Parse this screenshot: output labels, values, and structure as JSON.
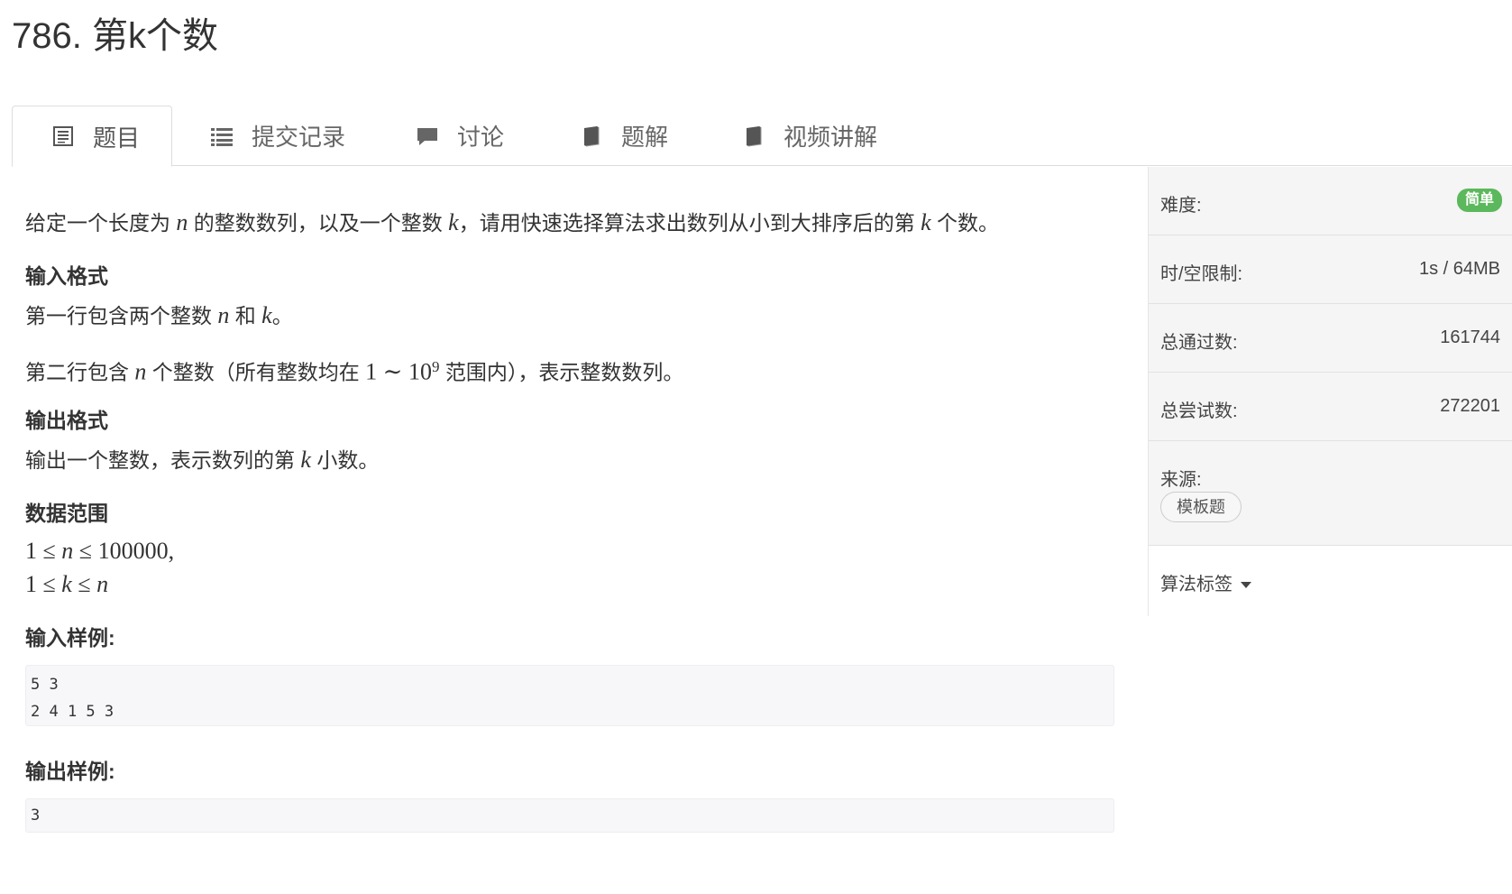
{
  "problem": {
    "title": "786. 第k个数"
  },
  "tabs": [
    {
      "label": "题目",
      "icon": "document-icon",
      "active": true
    },
    {
      "label": "提交记录",
      "icon": "list-icon"
    },
    {
      "label": "讨论",
      "icon": "comment-icon"
    },
    {
      "label": "题解",
      "icon": "book-icon"
    },
    {
      "label": "视频讲解",
      "icon": "book-icon"
    }
  ],
  "statement": {
    "desc_a": "给定一个长度为 ",
    "n": "n",
    "desc_b": " 的整数数列，以及一个整数 ",
    "k": "k",
    "desc_c": "，请用快速选择算法求出数列从小到大排序后的第 ",
    "desc_d": " 个数。"
  },
  "input_format": {
    "heading": "输入格式",
    "line1_a": "第一行包含两个整数 ",
    "line1_b": " 和 ",
    "line1_c": "。",
    "line2_a": "第二行包含 ",
    "line2_b": " 个整数（所有整数均在 ",
    "range_lo": "1",
    "tilde": " ∼ ",
    "range_hi_base": "10",
    "range_hi_exp": "9",
    "line2_c": " 范围内），表示整数数列。"
  },
  "output_format": {
    "heading": "输出格式",
    "line_a": "输出一个整数，表示数列的第 ",
    "line_b": " 小数。"
  },
  "data_range": {
    "heading": "数据范围",
    "one": "1",
    "le": " ≤ ",
    "max_n": "100000",
    "comma": ","
  },
  "samples": {
    "input_heading": "输入样例:",
    "input_text": "5 3\n2 4 1 5 3",
    "output_heading": "输出样例:",
    "output_text": "3"
  },
  "sidebar": {
    "difficulty_label": "难度:",
    "difficulty_value": "简单",
    "limit_label": "时/空限制:",
    "limit_value": "1s / 64MB",
    "passed_label": "总通过数:",
    "passed_value": "161744",
    "attempts_label": "总尝试数:",
    "attempts_value": "272201",
    "source_label": "来源:",
    "source_value": "模板题",
    "tags_label": "算法标签"
  },
  "colors": {
    "badge_green": "#5cb85c",
    "sidebar_bg": "#f5f5f5",
    "code_bg": "#f7f7f9"
  }
}
